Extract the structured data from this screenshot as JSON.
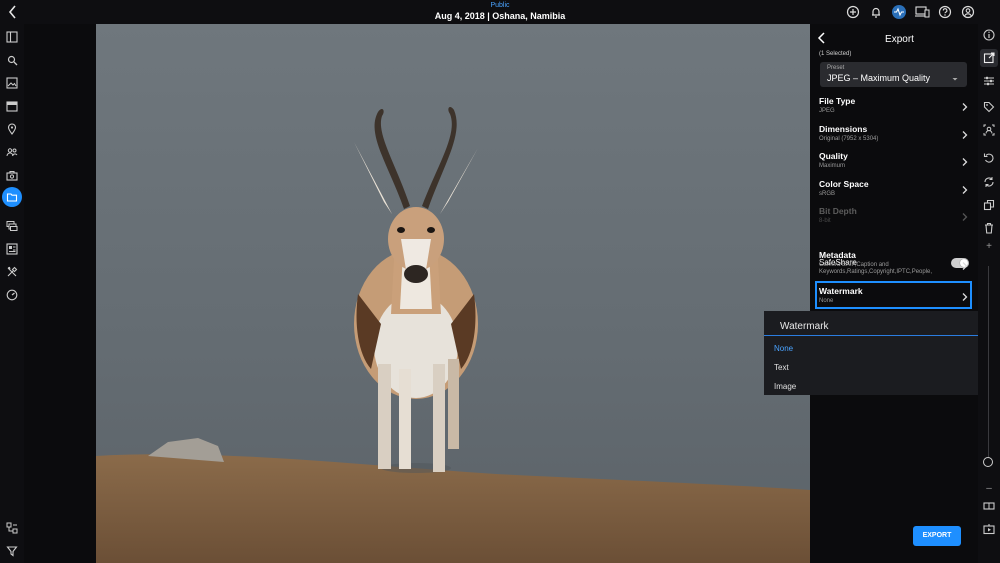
{
  "header": {
    "visibility": "Public",
    "title": "Aug 4, 2018 | Oshana, Namibia",
    "icons": [
      "add-icon",
      "bell-icon",
      "activity-icon",
      "devices-icon",
      "help-icon",
      "user-icon"
    ]
  },
  "left_rail": {
    "icons": [
      "sidebar-toggle-icon",
      "search-icon",
      "image-icon",
      "calendar-icon",
      "location-icon",
      "people-icon",
      "camera-bag-icon",
      "folder-icon",
      "stack-icon",
      "album-icon",
      "tools-icon",
      "dashboard-icon",
      "hierarchy-icon",
      "filter-icon"
    ],
    "active": "folder-icon"
  },
  "export_panel": {
    "title": "Export",
    "selected_count": "(1 Selected)",
    "preset": {
      "label": "Preset",
      "value": "JPEG – Maximum Quality"
    },
    "rows": [
      {
        "label": "File Type",
        "value": "JPEG",
        "disabled": false
      },
      {
        "label": "Dimensions",
        "value": "Original (7952 x 5304)",
        "disabled": false
      },
      {
        "label": "Quality",
        "value": "Maximum",
        "disabled": false
      },
      {
        "label": "Color Space",
        "value": "sRGB",
        "disabled": false
      },
      {
        "label": "Bit Depth",
        "value": "8-bit",
        "disabled": true
      }
    ],
    "safeshare": {
      "label": "SafeShare",
      "on": false
    },
    "metadata": {
      "label": "Metadata",
      "value": "Camera EXIF,Caption and Keywords,Ratings,Copyright,IPTC,People,"
    },
    "watermark": {
      "label": "Watermark",
      "value": "None"
    },
    "export_button": "EXPORT"
  },
  "watermark_dropdown": {
    "title": "Watermark",
    "options": [
      "None",
      "Text",
      "Image"
    ],
    "selected": "None"
  },
  "right_rail": {
    "icons": [
      "info-icon",
      "export-icon",
      "adjust-icon",
      "tag-icon",
      "face-icon",
      "rotate-icon",
      "sync-icon",
      "copy-icon",
      "trash-icon",
      "plus-icon",
      "minus-icon",
      "compare-icon",
      "present-icon"
    ],
    "plus": "+",
    "minus": "–",
    "zoom_level": 0.02
  },
  "colors": {
    "accent": "#1e8fff",
    "panel_bg": "#0b0b0d",
    "dropdown_bg": "#1b1c20"
  }
}
